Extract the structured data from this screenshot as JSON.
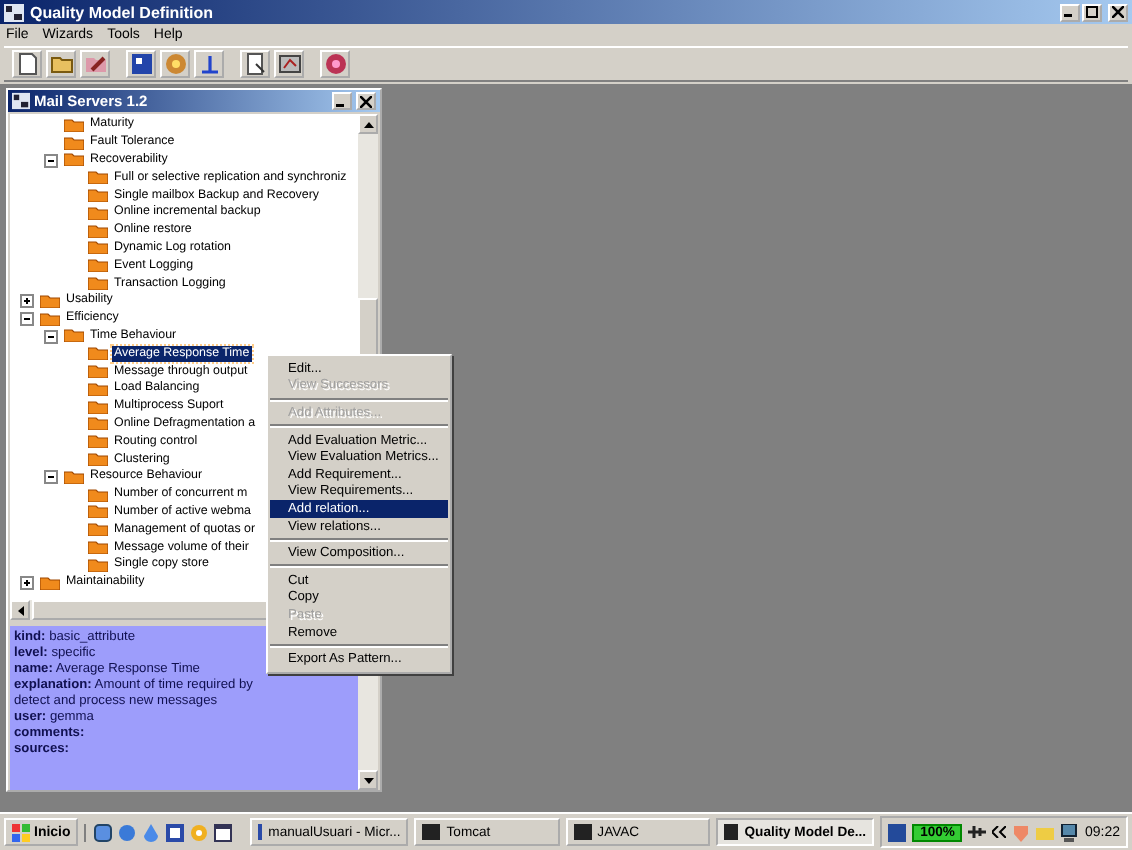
{
  "window": {
    "title": "Quality Model Definition"
  },
  "menu_bar": [
    "File",
    "Wizards",
    "Tools",
    "Help"
  ],
  "child_window": {
    "title": "Mail Servers 1.2"
  },
  "tree": {
    "items": [
      {
        "children": [
          {
            "label": "Maturity",
            "selected": false
          },
          {
            "label": "Fault Tolerance",
            "selected": false
          },
          {
            "label": "Recoverability",
            "selected": false,
            "expanded": true,
            "children": [
              {
                "label": "Full or selective replication and synchroniz",
                "selected": false
              },
              {
                "label": "Single mailbox Backup and Recovery",
                "selected": false
              },
              {
                "label": "Online incremental backup",
                "selected": false
              },
              {
                "label": "Online restore",
                "selected": false
              },
              {
                "label": "Dynamic Log rotation",
                "selected": false
              },
              {
                "label": "Event Logging",
                "selected": false
              },
              {
                "label": "Transaction Logging",
                "selected": false
              }
            ]
          }
        ]
      },
      {
        "label": "Usability",
        "selected": false,
        "expanded": false
      },
      {
        "label": "Efficiency",
        "selected": false,
        "expanded": true,
        "children": [
          {
            "label": "Time Behaviour",
            "selected": false,
            "expanded": true,
            "children": [
              {
                "label": "Average Response Time",
                "selected": true
              },
              {
                "label": "Message through output",
                "selected": false
              },
              {
                "label": "Load Balancing",
                "selected": false
              },
              {
                "label": "Multiprocess Suport",
                "selected": false
              },
              {
                "label": "Online Defragmentation a",
                "selected": false
              },
              {
                "label": "Routing control",
                "selected": false
              },
              {
                "label": "Clustering",
                "selected": false
              }
            ]
          },
          {
            "label": "Resource Behaviour",
            "selected": false,
            "expanded": true,
            "children": [
              {
                "label": "Number of concurrent m",
                "selected": false
              },
              {
                "label": "Number of active webma",
                "selected": false
              },
              {
                "label": "Management of quotas or",
                "selected": false
              },
              {
                "label": "Message volume of their",
                "selected": false
              },
              {
                "label": "Single copy store",
                "selected": false
              }
            ]
          }
        ]
      },
      {
        "label": "Maintainability",
        "selected": false,
        "expanded": false
      }
    ]
  },
  "details": [
    "**kind:** basic_attribute",
    "**level:** specific",
    "**name:** Average Response Time",
    "**explanation:** Amount of time required by detect and process new messages",
    "**user:** gemma",
    "**comments:**",
    "**sources:**"
  ],
  "context_menu": [
    {
      "kind": "item",
      "label": "Edit...",
      "disabled": false,
      "selected": false
    },
    {
      "kind": "item",
      "label": "View Successors",
      "disabled": true,
      "selected": false
    },
    {
      "kind": "separator"
    },
    {
      "kind": "item",
      "label": "Add Attributes...",
      "disabled": true,
      "selected": false
    },
    {
      "kind": "separator"
    },
    {
      "kind": "item",
      "label": "Add Evaluation Metric...",
      "disabled": false,
      "selected": false
    },
    {
      "kind": "item",
      "label": "View Evaluation Metrics...",
      "disabled": false,
      "selected": false
    },
    {
      "kind": "item",
      "label": "Add Requirement...",
      "disabled": false,
      "selected": false
    },
    {
      "kind": "item",
      "label": "View Requirements...",
      "disabled": false,
      "selected": false
    },
    {
      "kind": "item",
      "label": "Add relation...",
      "disabled": false,
      "selected": true
    },
    {
      "kind": "item",
      "label": "View relations...",
      "disabled": false,
      "selected": false
    },
    {
      "kind": "separator"
    },
    {
      "kind": "item",
      "label": "View Composition...",
      "disabled": false,
      "selected": false
    },
    {
      "kind": "separator"
    },
    {
      "kind": "item",
      "label": "Cut",
      "disabled": false,
      "selected": false
    },
    {
      "kind": "item",
      "label": "Copy",
      "disabled": false,
      "selected": false
    },
    {
      "kind": "item",
      "label": "Paste",
      "disabled": true,
      "selected": false
    },
    {
      "kind": "item",
      "label": "Remove",
      "disabled": false,
      "selected": false
    },
    {
      "kind": "separator"
    },
    {
      "kind": "item",
      "label": "Export As Pattern...",
      "disabled": false,
      "selected": false
    }
  ],
  "taskbar": {
    "start": "Inicio",
    "tasks": [
      {
        "label": "manualUsuari - Micr...",
        "selected": false
      },
      {
        "label": "Tomcat",
        "selected": false
      },
      {
        "label": "JAVAC",
        "selected": false
      },
      {
        "label": "Quality Model De...",
        "selected": true
      }
    ],
    "battery": "100%",
    "clock": "09:22"
  }
}
